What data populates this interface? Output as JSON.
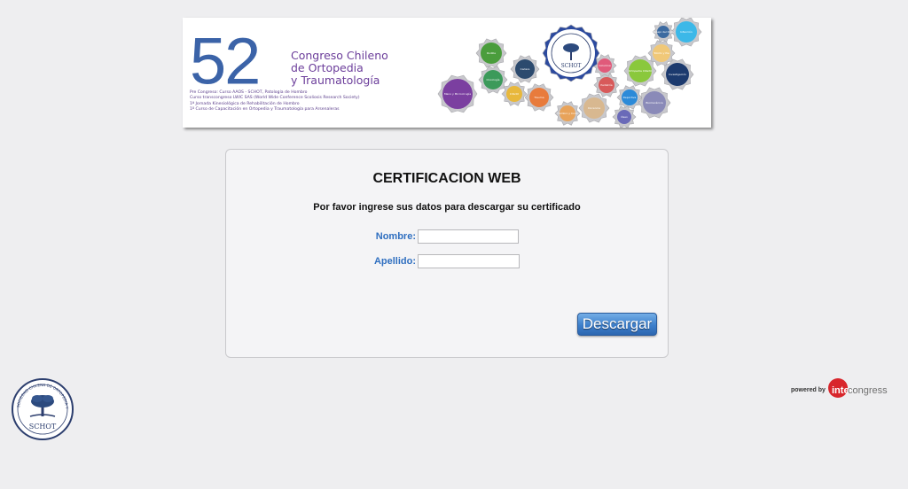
{
  "banner": {
    "number": "52",
    "degree": "°",
    "title_lines": [
      "Congreso Chileno",
      "de Ortopedia",
      "y Traumatología"
    ],
    "sub_lines": [
      "Pre Congreso: Curso AAOS - SCHOT, Patología de Hombro",
      "Curso transcongreso LWIC SAS (World Wide Conference Scoliosis Research Society)",
      "1ª Jornada Kinesiológica de Rehabilitación de Hombro",
      "1º Curso de Capacitación en Ortopedia y Traumatología para Arsenaleras"
    ],
    "gears": [
      {
        "label": "Rodilla",
        "color": "#4a9d3c"
      },
      {
        "label": "Cadera",
        "color": "#2c4a6e"
      },
      {
        "label": "Oncología",
        "color": "#3c9a5a"
      },
      {
        "label": "Mano y Microcirugía",
        "color": "#7b3fa0"
      },
      {
        "label": "Infantil",
        "color": "#e8b83c"
      },
      {
        "label": "Trauma",
        "color": "#e87b3c"
      },
      {
        "label": "Pediatría",
        "color": "#d85a5a"
      },
      {
        "label": "Hombro y Codo",
        "color": "#e8a35a"
      },
      {
        "label": "Columna",
        "color": "#e05a7a"
      },
      {
        "label": "Deportiva",
        "color": "#2c8ad8"
      },
      {
        "label": "Ortopedia Infantil",
        "color": "#8ac83c"
      },
      {
        "label": "Investigación",
        "color": "#1c3a6e"
      },
      {
        "label": "Tobillo y Pie",
        "color": "#f0c878"
      },
      {
        "label": "Infección",
        "color": "#3cb8e8"
      },
      {
        "label": "Manejo del Dolor",
        "color": "#3c6aa0"
      },
      {
        "label": "Docencia",
        "color": "#d8b890"
      },
      {
        "label": "Óseo",
        "color": "#6a6ab8"
      },
      {
        "label": "Biomecánica",
        "color": "#8a8ab8"
      }
    ],
    "center_emblem": "SCHOT"
  },
  "form": {
    "title": "CERTIFICACION WEB",
    "instructions": "Por favor ingrese sus datos para descargar su certificado",
    "nombre_label": "Nombre:",
    "nombre_value": "",
    "apellido_label": "Apellido:",
    "apellido_value": "",
    "submit_label": "Descargar"
  },
  "footer": {
    "left_logo_text": "SCHOT",
    "left_logo_ring": "SOCIEDAD CHILENA DE ORTOPEDIA Y TRAUMATOLOGÍA",
    "powered_text": "powered by",
    "brand_part1": "inter",
    "brand_part2": "congress"
  },
  "colors": {
    "background": "#eeeef0",
    "accent_blue": "#2f6fc0",
    "banner_blue": "#3b63a8",
    "banner_purple": "#6b3d9a",
    "brand_red": "#d8262c"
  }
}
